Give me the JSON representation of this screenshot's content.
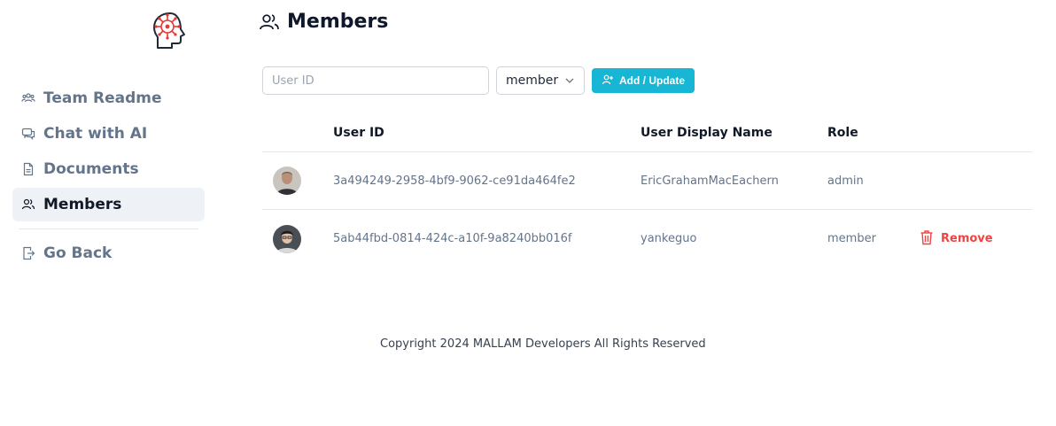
{
  "sidebar": {
    "logo_icon": "brain-circuit-icon",
    "items": [
      {
        "label": "Team Readme",
        "icon": "team-icon",
        "active": false
      },
      {
        "label": "Chat with AI",
        "icon": "chat-icon",
        "active": false
      },
      {
        "label": "Documents",
        "icon": "document-icon",
        "active": false
      },
      {
        "label": "Members",
        "icon": "members-icon",
        "active": true
      }
    ],
    "back": {
      "label": "Go Back",
      "icon": "logout-icon"
    }
  },
  "page": {
    "title": "Members",
    "title_icon": "members-icon"
  },
  "toolbar": {
    "user_id_placeholder": "User ID",
    "user_id_value": "",
    "role_selected": "member",
    "add_label": "Add / Update"
  },
  "table": {
    "headers": {
      "user_id": "User ID",
      "display_name": "User Display Name",
      "role": "Role"
    },
    "rows": [
      {
        "user_id": "3a494249-2958-4bf9-9062-ce91da464fe2",
        "display_name": "EricGrahamMacEachern",
        "role": "admin",
        "action": ""
      },
      {
        "user_id": "5ab44fbd-0814-424c-a10f-9a8240bb016f",
        "display_name": "yankeguo",
        "role": "member",
        "action": "Remove"
      }
    ]
  },
  "footer": {
    "text": "Copyright 2024 MALLAM Developers All Rights Reserved"
  },
  "colors": {
    "accent": "#16b6d4",
    "danger": "#ef4444",
    "logo": "#e53935"
  }
}
